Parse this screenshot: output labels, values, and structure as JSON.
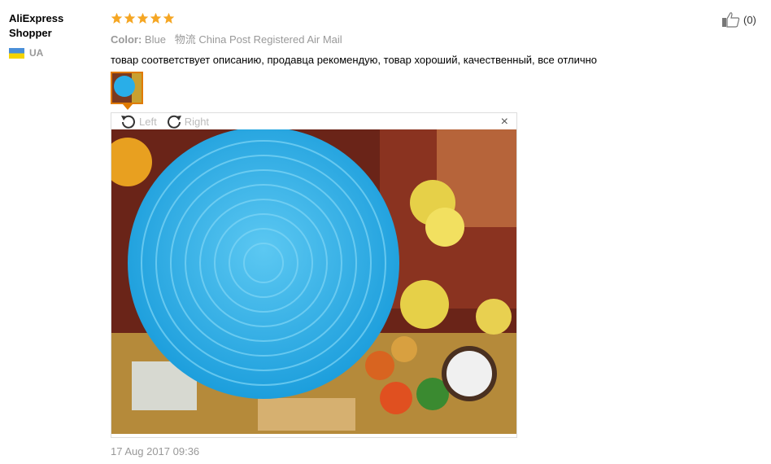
{
  "user": {
    "name": "AliExpress Shopper",
    "country": "UA"
  },
  "review": {
    "stars": 5,
    "color_label": "Color:",
    "color_value": "Blue",
    "shipping": "物流 China Post Registered Air Mail",
    "text": "товар соответствует описанию, продавца рекомендую, товар хороший, качественный, все отлично",
    "date": "17 Aug 2017 09:36"
  },
  "viewer": {
    "rotate_left": "Left",
    "rotate_right": "Right",
    "close": "×"
  },
  "helpful": {
    "count": "(0)"
  },
  "colors": {
    "star": "#f5a623",
    "thumb_border": "#e07a00",
    "plate": "#29aee8"
  }
}
